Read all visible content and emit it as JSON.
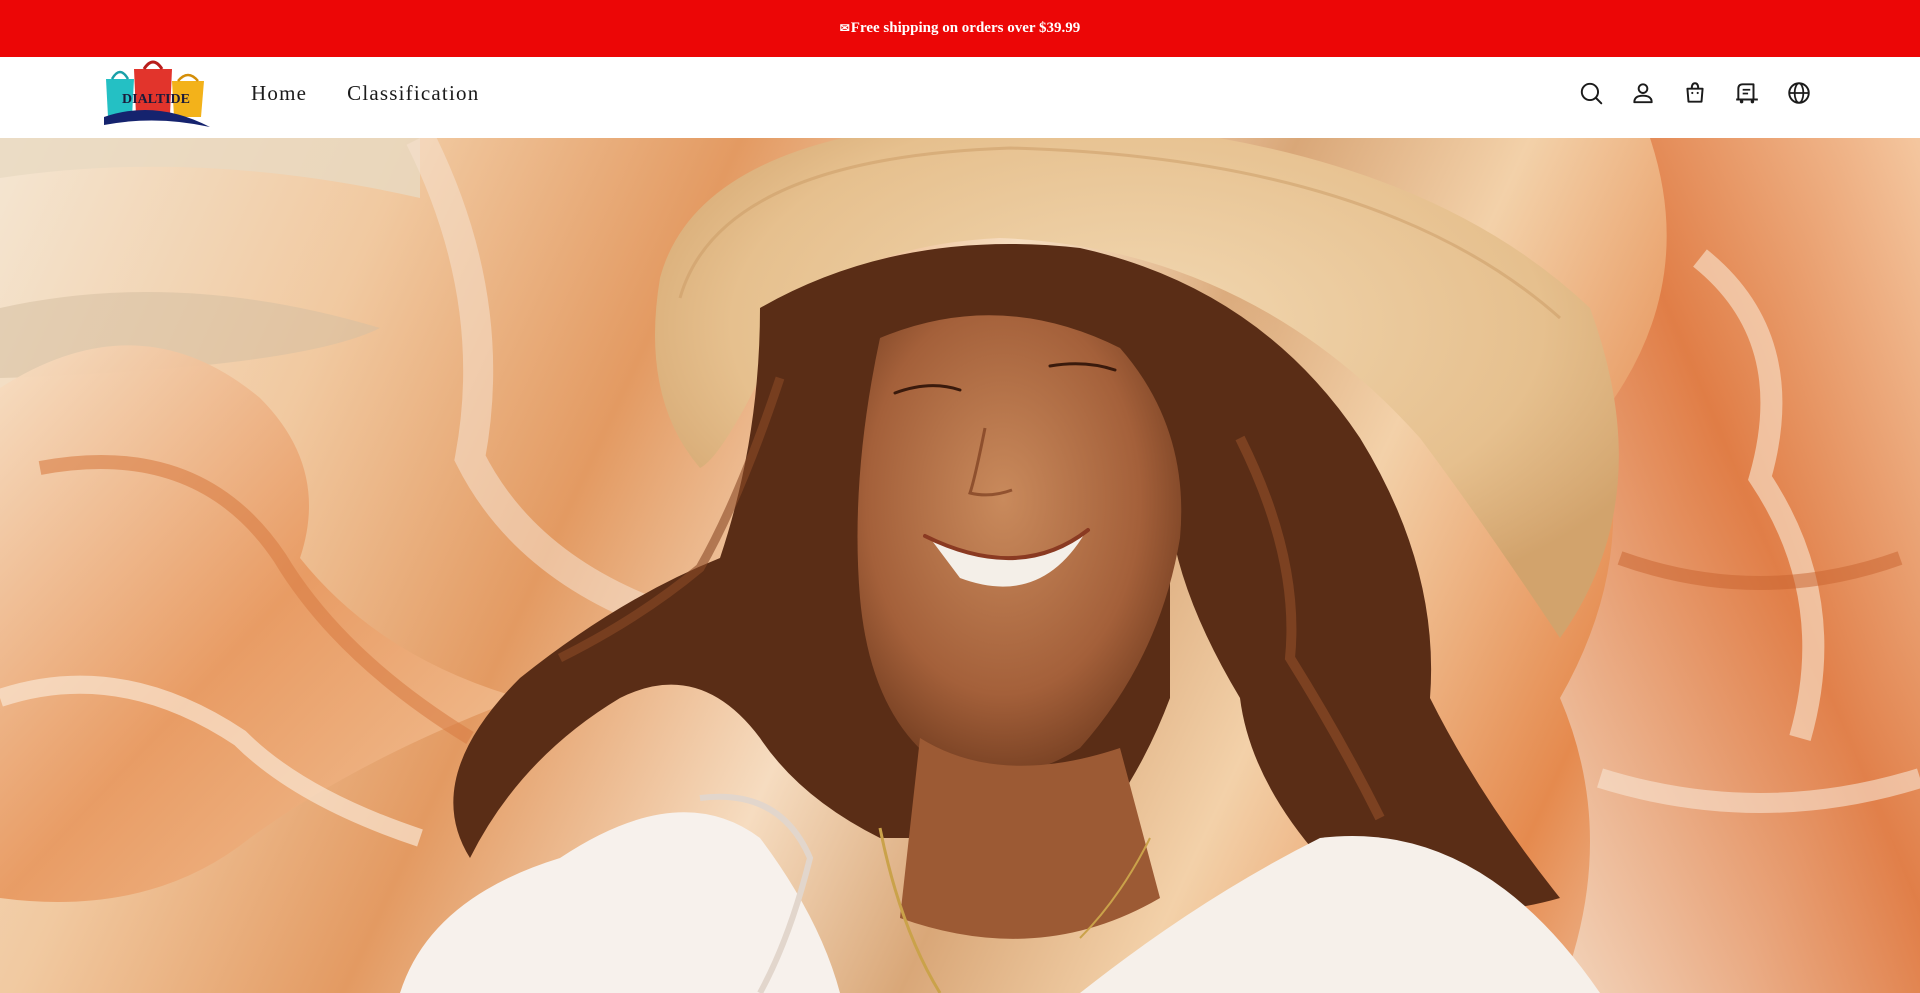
{
  "announcement": {
    "text": "Free shipping on orders over $39.99",
    "background": "#ec0606",
    "color": "#ffffff"
  },
  "header": {
    "logo": {
      "text": "DIALTIDE",
      "icon": "shopping-bags-logo"
    },
    "nav": [
      {
        "label": "Home"
      },
      {
        "label": "Classification"
      }
    ],
    "icons": [
      "search-icon",
      "account-icon",
      "cart-icon",
      "order-tracking-icon",
      "language-globe-icon"
    ]
  },
  "hero": {
    "image": "woman-in-straw-sun-hat-with-flowing-orange-fabric"
  }
}
